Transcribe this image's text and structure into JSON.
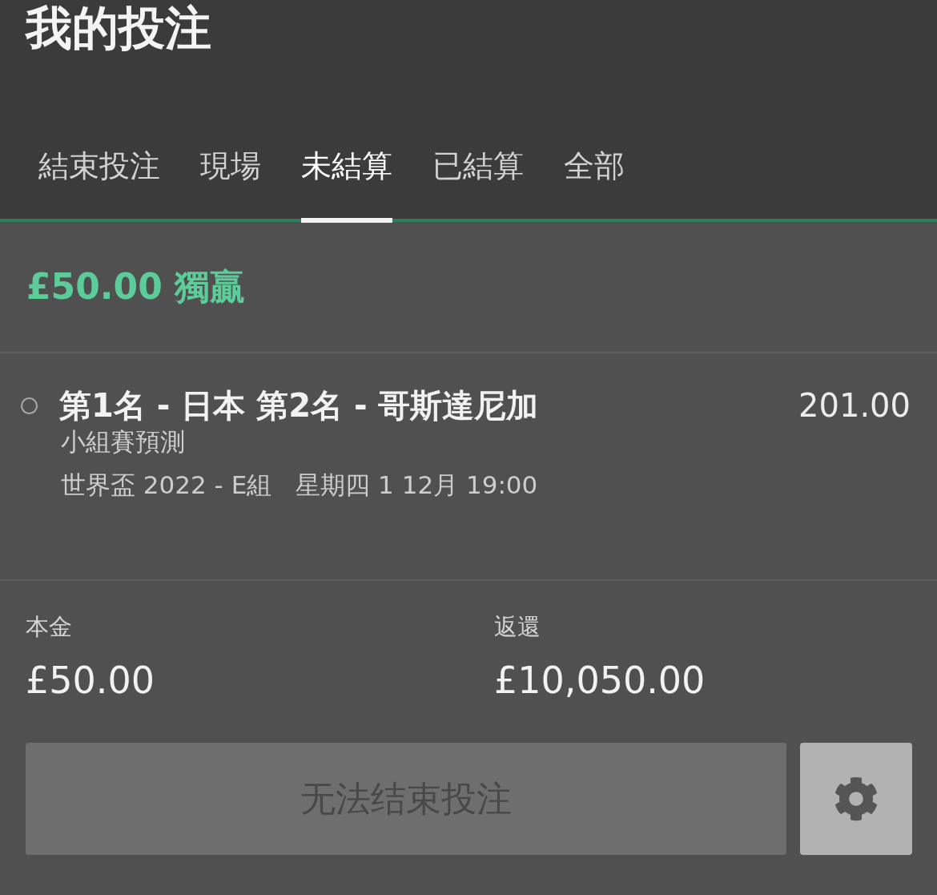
{
  "header": {
    "title": "我的投注"
  },
  "tabs": [
    {
      "label": "結束投注",
      "selected": false
    },
    {
      "label": "現場",
      "selected": false
    },
    {
      "label": "未結算",
      "selected": true
    },
    {
      "label": "已結算",
      "selected": false
    },
    {
      "label": "全部",
      "selected": false
    }
  ],
  "bet": {
    "heading": "£50.00 獨贏"
  },
  "selection": {
    "name": "第1名 - 日本 第2名 - 哥斯達尼加",
    "odds": "201.00",
    "market": "小組賽預測",
    "event": "世界盃 2022 - E組",
    "start_time": "星期四 1 12月 19:00"
  },
  "summary": [
    {
      "label": "本金",
      "value": "£50.00"
    },
    {
      "label": "返還",
      "value": "£10,050.00"
    }
  ],
  "cash_out": {
    "label": "无法结束投注",
    "disabled": true
  }
}
